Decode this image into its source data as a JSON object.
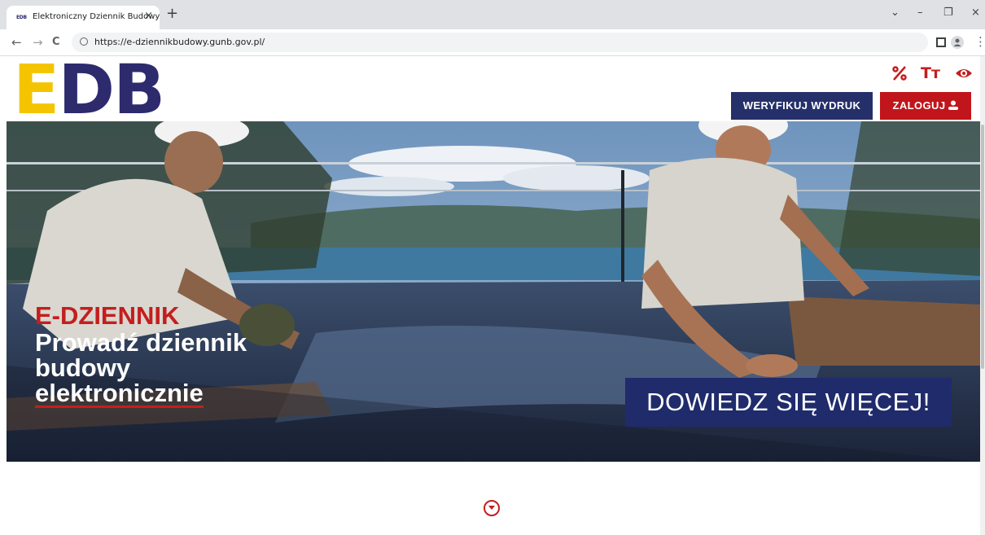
{
  "browser": {
    "tab_favicon": "EDB",
    "tab_title": "Elektroniczny Dziennik Budowy",
    "tab_close": "×",
    "new_tab": "+",
    "window_controls": {
      "dropdown": "⌄",
      "minimize": "–",
      "restore": "❐",
      "close": "×"
    },
    "nav": {
      "back": "←",
      "forward": "→",
      "reload": "C"
    },
    "url": "https://e-dziennikbudowy.gunb.gov.pl/",
    "menu": "⋮"
  },
  "site": {
    "logo": {
      "e": "E",
      "db": "DB"
    },
    "accessibility": {
      "contrast_icon": "percent-contrast-icon",
      "font_size": "Tт",
      "visibility_icon": "eye-icon"
    },
    "buttons": {
      "verify": "WERYFIKUJ WYDRUK",
      "login": "ZALOGUJ"
    }
  },
  "hero": {
    "kicker": "E-DZIENNIK",
    "title_line1": "Prowadź dziennik",
    "title_line2": "budowy",
    "title_line3": "elektronicznie",
    "cta": "DOWIEDZ SIĘ WIĘCEJ!"
  },
  "colors": {
    "brand_navy": "#2d2a6e",
    "brand_yellow": "#f5c400",
    "accent_red": "#c0161b",
    "button_navy": "#25306b"
  }
}
